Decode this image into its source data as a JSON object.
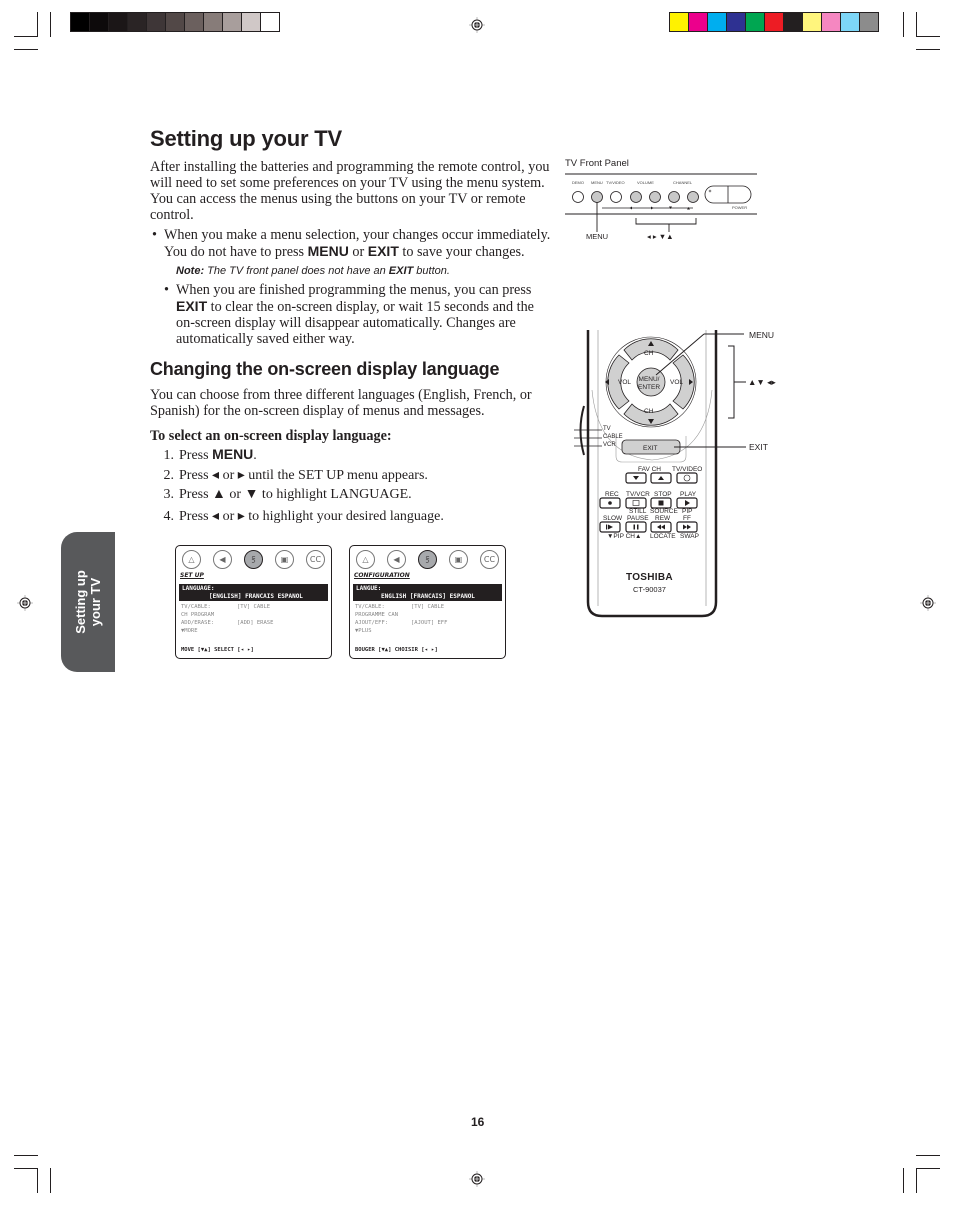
{
  "print_marks": {
    "gray_bar": [
      "#000000",
      "#0d0a0b",
      "#1b1617",
      "#2a2425",
      "#3e3637",
      "#524847",
      "#6b605e",
      "#877c79",
      "#a89e9c",
      "#d0c8c7",
      "#ffffff"
    ],
    "color_bar": [
      "#fff200",
      "#ec008c",
      "#00aeef",
      "#2e3192",
      "#00a651",
      "#ed1c24",
      "#231f20",
      "#fff57d",
      "#f587c1",
      "#7dd6f7",
      "#8c8c8c"
    ]
  },
  "page": {
    "title": "Setting up your TV",
    "intro": "After installing the batteries and programming the remote control, you will need to set some preferences on your TV using the menu system. You can access the menus using the buttons on your TV or remote control.",
    "bullet1": {
      "pre": "When you make a menu selection, your changes occur immediately. You do not have to press ",
      "kw1": "MENU",
      "mid": " or ",
      "kw2": "EXIT",
      "post": " to save your changes."
    },
    "note": {
      "label": "Note:",
      "pre": " The TV front panel does not have an ",
      "kw": "EXIT",
      "post": " button."
    },
    "bullet2": {
      "pre": "When you are finished programming the menus, you can press ",
      "kw": "EXIT",
      "post": " to clear the on-screen display, or wait 15 seconds and the on-screen display will disappear automatically. Changes are automatically saved either way."
    },
    "section_title": "Changing the on-screen display language",
    "section_intro": "You can choose from three different languages (English, French, or Spanish) for the on-screen display of menus and messages.",
    "procedure_title": "To select an on-screen display language:",
    "steps": [
      {
        "num": "1.",
        "pre": "Press ",
        "kw": "MENU",
        "post": "."
      },
      {
        "num": "2.",
        "text": "Press ◂ or ▸ until the SET UP menu appears."
      },
      {
        "num": "3.",
        "text": "Press ▲ or ▼ to highlight LANGUAGE."
      },
      {
        "num": "4.",
        "text": "Press ◂ or ▸ to highlight your desired language."
      }
    ],
    "side_tab": [
      "Setting up",
      "your TV"
    ],
    "page_number": "16"
  },
  "osd_english": {
    "icons": [
      "picture-icon",
      "audio-icon",
      "setup-icon",
      "theater-icon",
      "cc-icon"
    ],
    "icon_glyphs": [
      "△",
      "◀",
      "⫓",
      "▣",
      "CC"
    ],
    "title": "SET UP",
    "hl_label": "LANGUAGE:",
    "hl_options": "[ENGLISH] FRANCAIS ESPANOL",
    "rows": [
      {
        "k": "TV/CABLE:",
        "v": "[TV] CABLE"
      },
      {
        "k": "CH PROGRAM",
        "v": ""
      },
      {
        "k": "ADD/ERASE:",
        "v": "[ADD] ERASE"
      },
      {
        "k": "▼MORE",
        "v": ""
      }
    ],
    "footer": "MOVE [▼▲]    SELECT [◂ ▸]"
  },
  "osd_french": {
    "icons": [
      "picture-icon",
      "audio-icon",
      "setup-icon",
      "theater-icon",
      "cc-icon"
    ],
    "icon_glyphs": [
      "△",
      "◀",
      "⫓",
      "▣",
      "CC"
    ],
    "title": "CONFIGURATION",
    "hl_label": "LANGUE:",
    "hl_options": "ENGLISH [FRANCAIS] ESPANOL",
    "rows": [
      {
        "k": "TV/CABLE:",
        "v": "[TV] CABLE"
      },
      {
        "k": "PROGRAMME CAN",
        "v": ""
      },
      {
        "k": "AJOUT/EFF:",
        "v": "[AJOUT] EFF"
      },
      {
        "k": "▼PLUS",
        "v": ""
      }
    ],
    "footer": "BOUGER [▼▲]    CHOISIR [◂ ▸]"
  },
  "front_panel": {
    "title": "TV Front Panel",
    "labels": [
      "DEMO",
      "MENU",
      "TV/VIDEO",
      "VOLUME",
      "CHANNEL"
    ],
    "power": "POWER",
    "callout_menu": "MENU",
    "callout_arrows": "◂ ▸ ▼▲"
  },
  "remote": {
    "ch": "CH",
    "vol": "VOL",
    "center": [
      "MENU/",
      "ENTER"
    ],
    "modes": [
      "TV",
      "CABLE",
      "VCR"
    ],
    "exit": "EXIT",
    "fav_ch": "FAV CH",
    "tv_video": "TV/VIDEO",
    "row1": [
      "REC",
      "TV/VCR",
      "STOP",
      "PLAY"
    ],
    "row1_sub": [
      "",
      "STILL",
      "SOURCE",
      "PIP"
    ],
    "row2": [
      "SLOW",
      "PAUSE",
      "REW",
      "FF"
    ],
    "row2_sub": [
      "▼PIP CH▲",
      "",
      "LOCATE",
      "SWAP"
    ],
    "brand": "TOSHIBA",
    "model": "CT-90037",
    "callout_menu": "MENU",
    "callout_arrows": "▲▼ ◂▸",
    "callout_exit": "EXIT"
  }
}
